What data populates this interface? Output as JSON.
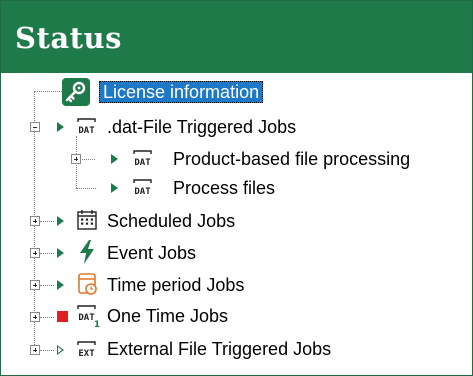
{
  "header": {
    "title": "Status"
  },
  "tree": {
    "items": [
      {
        "label": "License information"
      },
      {
        "label": ".dat-File Triggered Jobs"
      },
      {
        "label": "Product-based file processing"
      },
      {
        "label": "Process files"
      },
      {
        "label": "Scheduled Jobs"
      },
      {
        "label": "Event Jobs"
      },
      {
        "label": "Time period Jobs"
      },
      {
        "label": "One Time Jobs"
      },
      {
        "label": "External File Triggered Jobs"
      }
    ],
    "icon_text": {
      "dat": "DAT",
      "ext": "EXT",
      "one": "1"
    }
  },
  "colors": {
    "header": "#1f7a4a",
    "selection": "#1d78c8",
    "play": "#1f7a4a",
    "stop": "#e02020",
    "accent_orange": "#e8762c"
  }
}
